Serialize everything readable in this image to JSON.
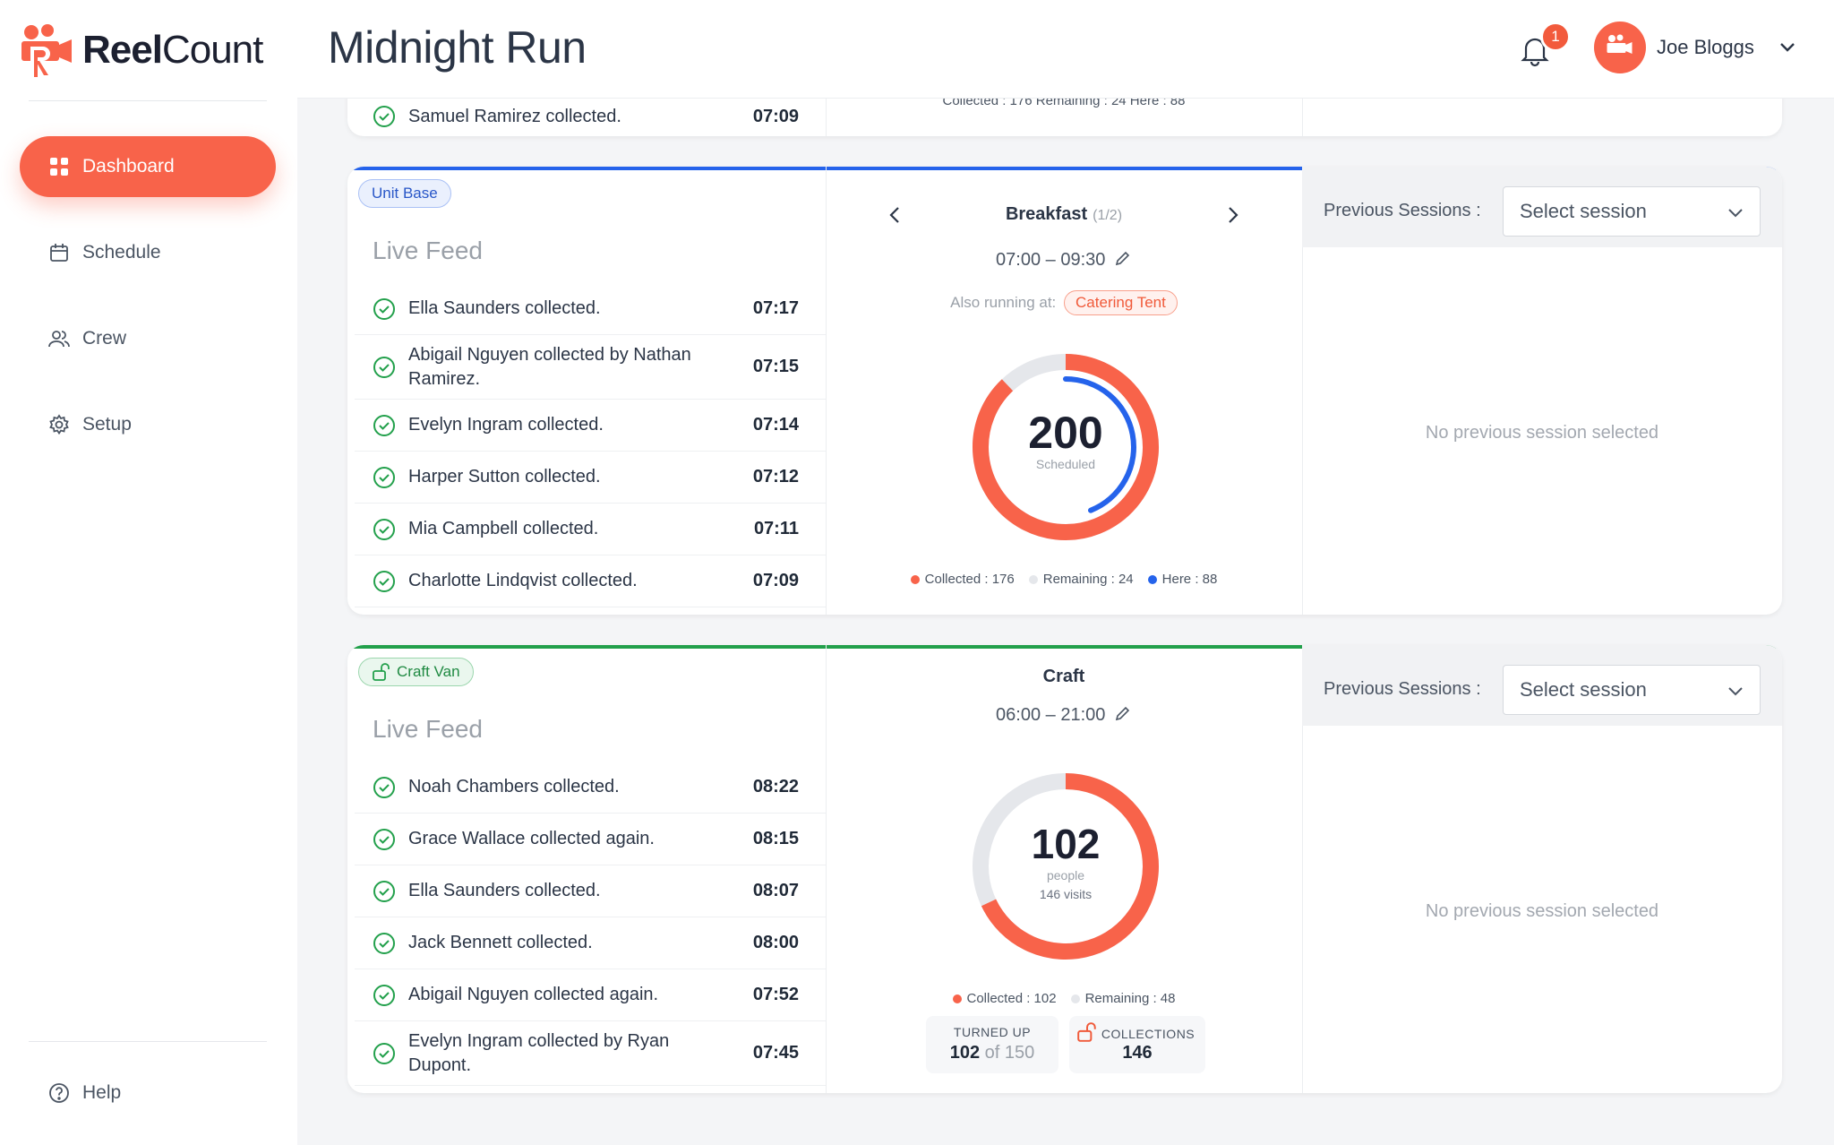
{
  "brand": {
    "name_bold": "Reel",
    "name_light": "Count"
  },
  "nav": {
    "items": [
      {
        "label": "Dashboard",
        "active": true
      },
      {
        "label": "Schedule"
      },
      {
        "label": "Crew"
      },
      {
        "label": "Setup"
      }
    ],
    "help": "Help"
  },
  "header": {
    "title": "Midnight Run",
    "notifications": "1",
    "user": "Joe Bloggs"
  },
  "colors": {
    "accent": "#f8634a",
    "blue": "#2563eb",
    "green": "#22a04b",
    "grey": "#e5e7eb"
  },
  "card0": {
    "last_row": {
      "text": "Samuel Ramirez collected.",
      "time": "07:09"
    },
    "legend": "Collected : 176  Remaining : 24  Here : 88"
  },
  "card1": {
    "tag": "Unit Base",
    "feed_title": "Live Feed",
    "feed": [
      {
        "text": "Ella Saunders collected.",
        "time": "07:17"
      },
      {
        "text": "Abigail Nguyen collected by Nathan Ramirez.",
        "time": "07:15"
      },
      {
        "text": "Evelyn Ingram collected.",
        "time": "07:14"
      },
      {
        "text": "Harper Sutton collected.",
        "time": "07:12"
      },
      {
        "text": "Mia Campbell collected.",
        "time": "07:11"
      },
      {
        "text": "Charlotte Lindqvist collected.",
        "time": "07:09"
      }
    ],
    "session": {
      "name": "Breakfast",
      "index": "(1/2)",
      "time": "07:00 – 09:30",
      "also_label": "Also running at:",
      "also_location": "Catering Tent",
      "total": "200",
      "total_label": "Scheduled",
      "collected": 176,
      "remaining": 24,
      "here": 88,
      "legend_collected": "Collected : 176",
      "legend_remaining": "Remaining : 24",
      "legend_here": "Here : 88"
    },
    "prev_label": "Previous Sessions :",
    "select": "Select session",
    "no_prev": "No previous session selected"
  },
  "card2": {
    "tag": "Craft Van",
    "feed_title": "Live Feed",
    "feed": [
      {
        "text": "Noah Chambers collected.",
        "time": "08:22"
      },
      {
        "text": "Grace Wallace collected again.",
        "time": "08:15"
      },
      {
        "text": "Ella Saunders collected.",
        "time": "08:07"
      },
      {
        "text": "Jack Bennett collected.",
        "time": "08:00"
      },
      {
        "text": "Abigail Nguyen collected again.",
        "time": "07:52"
      },
      {
        "text": "Evelyn Ingram collected by Ryan Dupont.",
        "time": "07:45"
      }
    ],
    "session": {
      "name": "Craft",
      "time": "06:00 – 21:00",
      "total": "102",
      "total_label": "people",
      "visits": "146 visits",
      "collected": 102,
      "remaining": 48,
      "legend_collected": "Collected : 102",
      "legend_remaining": "Remaining : 48",
      "turned_up_label": "TURNED UP",
      "turned_up_value": "102",
      "turned_up_of": "of 150",
      "collections_label": "COLLECTIONS",
      "collections_value": "146"
    },
    "prev_label": "Previous Sessions :",
    "select": "Select session",
    "no_prev": "No previous session selected"
  }
}
